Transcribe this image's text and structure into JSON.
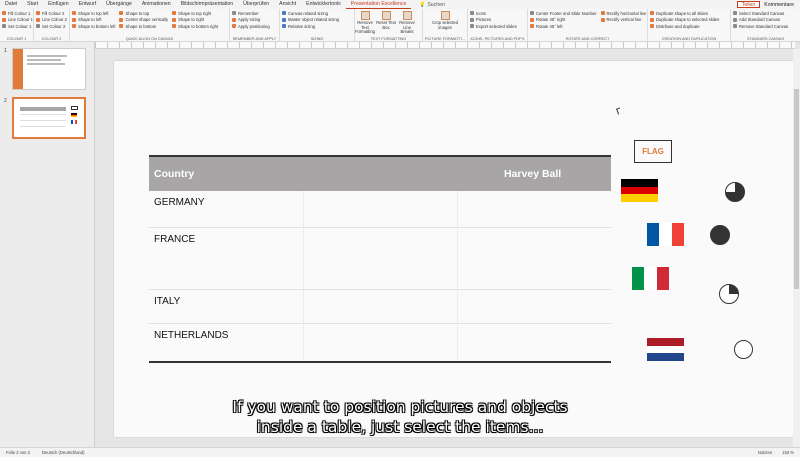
{
  "menu": {
    "tabs": [
      "Datei",
      "Start",
      "Einfügen",
      "Entwurf",
      "Übergänge",
      "Animationen",
      "Bildschirmpräsentation",
      "Überprüfen",
      "Ansicht",
      "Entwicklertools",
      "Presentation Excellence"
    ],
    "search": "Suchen",
    "share": "Teilen",
    "comments": "Kommentare"
  },
  "ribbon": {
    "colour1": {
      "items": [
        "Fill Colour 1",
        "Line Colour 1",
        "Set Colour 1"
      ],
      "label": "COLOUR 1"
    },
    "colour2": {
      "items": [
        "Fill Colour 2",
        "Line Colour 2",
        "Set Colour 2"
      ],
      "label": "COLOUR 2"
    },
    "align": {
      "col1": [
        "Shape to top left",
        "Shape to left",
        "Shape to bottom left"
      ],
      "col2": [
        "Shape to top",
        "Center shape vertically",
        "Shape to bottom"
      ],
      "col3": [
        "Shape to top right",
        "Shape to right",
        "Shape to bottom right"
      ],
      "label": "QUICK ALIGN ON CANVAS"
    },
    "remember": {
      "items": [
        "Remember",
        "Apply sizing",
        "Apply positioning"
      ],
      "label": "REMEMBER AND APPLY"
    },
    "sizing": {
      "items": [
        "Canvas related sizing",
        "Master object related sizing",
        "Relative sizing"
      ],
      "label": "SIZING"
    },
    "text": {
      "buttons": [
        "Remove Text Formatting",
        "Reset Text Box",
        "Remove Line Breaks"
      ],
      "label": "TEXT FORMATTING"
    },
    "picture": {
      "buttons": [
        "Crop selected images"
      ],
      "label": "PICTURE FORMATTI..."
    },
    "icons": {
      "items": [
        "Icons",
        "Pictures",
        "Export selected slides"
      ],
      "label": "ICONS, PICTURES AND PDF'S"
    },
    "rotate": {
      "col1": [
        "Center Footer and Slide Number",
        "Rotate 45° right",
        "Rotate 45° left"
      ],
      "col2": [
        "Rectify horizontal line",
        "Rectify vertical line"
      ],
      "label": "ROTATE AND CORRECT"
    },
    "creation": {
      "items": [
        "Duplicate shape to all slides",
        "Duplicate shape to selected slides",
        "Distribute and duplicate"
      ],
      "label": "CREATION AND DUPLICATION"
    },
    "standard": {
      "items": [
        "Select Standard Canvas",
        "Add Standard Canvas",
        "Remove Standard Canvas"
      ],
      "label": "STANDARD CANVAS"
    }
  },
  "thumbnails": [
    {
      "number": "1"
    },
    {
      "number": "2"
    }
  ],
  "slide": {
    "table": {
      "headers": [
        "Country",
        "Harvey Ball"
      ],
      "rows": [
        "GERMANY",
        "FRANCE",
        "ITALY",
        "NETHERLANDS"
      ]
    },
    "flag_label": "FLAG",
    "harvey_balls": [
      0.75,
      1.0,
      0.25,
      0.0
    ],
    "colors": {
      "accent": "#e07b39",
      "header_bg": "#a7a5a6"
    }
  },
  "subtitles": {
    "line1": "If you want to position pictures and objects",
    "line2": "inside a table, just select the items..."
  },
  "status": {
    "slide_info": "Folie 2 von 2",
    "language": "Deutsch (Deutschland)",
    "notes": "Notizen",
    "zoom": "153 %"
  }
}
